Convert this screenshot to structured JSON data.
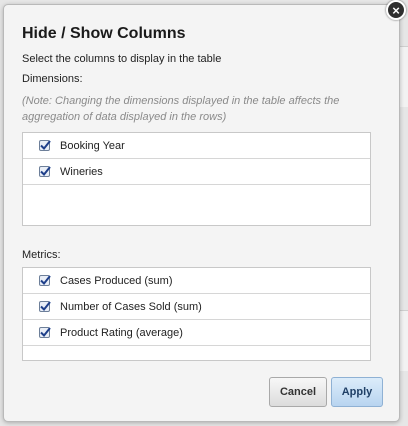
{
  "dialog": {
    "title": "Hide / Show Columns",
    "close_label": "×",
    "instruction": "Select the columns to display in the table",
    "dimensions_label": "Dimensions:",
    "note": "(Note: Changing the dimensions displayed in the table affects the aggregation of data displayed in the rows)",
    "dimensions": [
      {
        "label": "Booking Year",
        "checked": true
      },
      {
        "label": "Wineries",
        "checked": true
      }
    ],
    "metrics_label": "Metrics:",
    "metrics": [
      {
        "label": "Cases Produced (sum)",
        "checked": true
      },
      {
        "label": "Number of Cases Sold (sum)",
        "checked": true
      },
      {
        "label": "Product Rating (average)",
        "checked": true
      }
    ],
    "cancel_label": "Cancel",
    "apply_label": "Apply"
  },
  "colors": {
    "apply_bg": "#c8dff5",
    "dialog_bg": "#f4f4f4",
    "note_text": "#8a8a8a"
  }
}
